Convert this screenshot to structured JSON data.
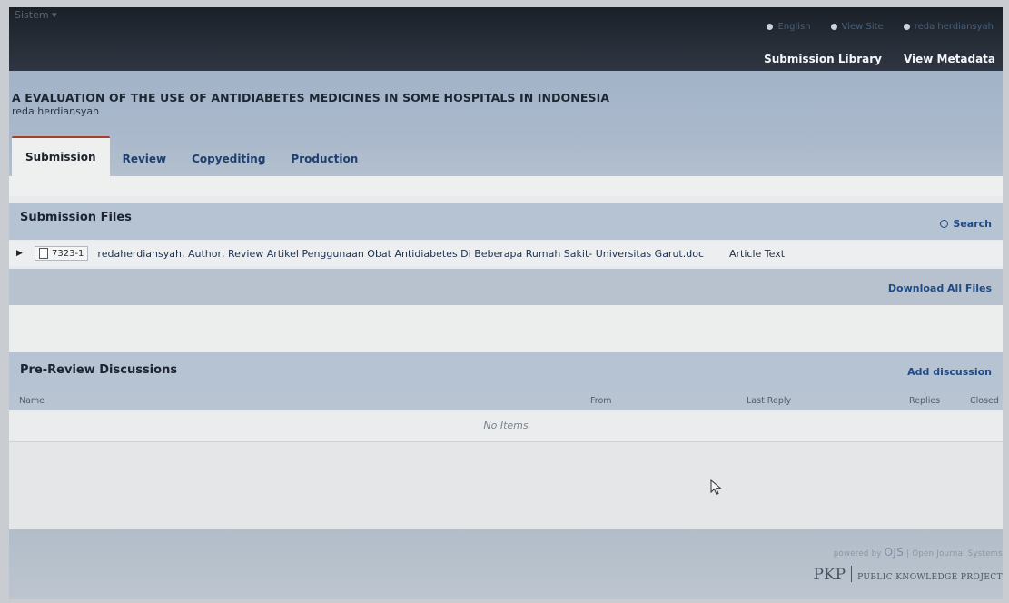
{
  "header": {
    "site_menu": "Sistem ▾",
    "user_nav": [
      "English",
      "View Site",
      "reda herdiansyah"
    ],
    "title_nav": [
      "Submission Library",
      "View Metadata"
    ]
  },
  "submission": {
    "title": "A EVALUATION OF THE USE OF ANTIDIABETES MEDICINES IN SOME HOSPITALS IN INDONESIA",
    "author": "reda herdiansyah"
  },
  "tabs": [
    "Submission",
    "Review",
    "Copyediting",
    "Production"
  ],
  "active_tab": "Submission",
  "files": {
    "title": "Submission Files",
    "search_label": "Search",
    "rows": [
      {
        "id": "7323-1",
        "name": "redaherdiansyah, Author, Review Artikel Penggunaan Obat Antidiabetes Di Beberapa Rumah Sakit- Universitas Garut.doc",
        "type": "Article Text"
      }
    ],
    "download_all": "Download All Files"
  },
  "discussions": {
    "title": "Pre-Review Discussions",
    "add_label": "Add discussion",
    "columns": [
      "Name",
      "From",
      "Last Reply",
      "Replies",
      "Closed"
    ],
    "empty": "No Items"
  },
  "footer": {
    "powered_prefix": "powered by",
    "ojs": "OJS",
    "ojs_full": "Open Journal Systems",
    "pkp": "PKP",
    "pkp_full": "PUBLIC KNOWLEDGE PROJECT"
  },
  "colors": {
    "accent_tab": "#a3402e",
    "link": "#1f4a86",
    "panel_header": "#b6c3d2"
  }
}
